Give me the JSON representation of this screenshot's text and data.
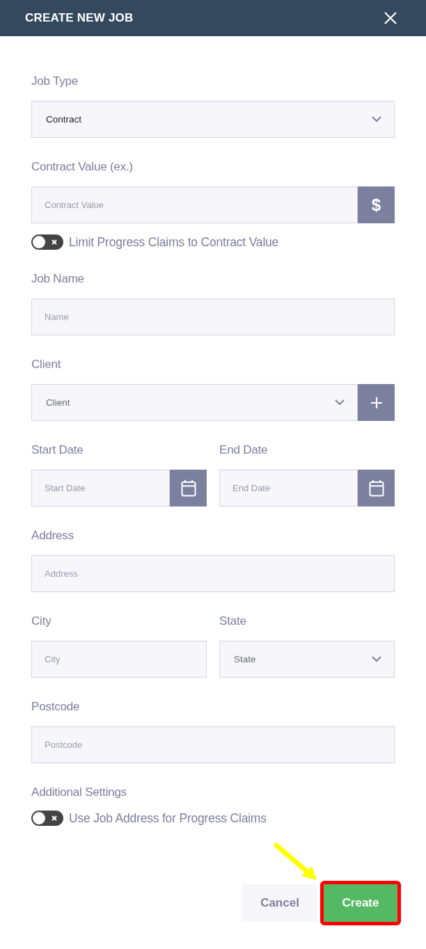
{
  "dialog": {
    "title": "CREATE NEW JOB"
  },
  "form": [
    {
      "kind": "select",
      "label": "Job Type",
      "value": "Contract"
    },
    {
      "kind": "input",
      "label": "Contract Value (ex.)",
      "placeholder": "Contract Value",
      "addon": {
        "kind": "text",
        "text": "$"
      }
    },
    {
      "kind": "toggle",
      "label": "Limit Progress Claims to Contract Value",
      "on": false
    },
    {
      "kind": "input",
      "label": "Job Name",
      "placeholder": "Name"
    },
    {
      "kind": "select",
      "label": "Client",
      "placeholder": "Client",
      "addon": {
        "kind": "add"
      }
    },
    {
      "kind": "row",
      "fields": [
        {
          "kind": "input",
          "label": "Start Date",
          "placeholder": "Start Date",
          "addon": {
            "kind": "calendar"
          }
        },
        {
          "kind": "input",
          "label": "End Date",
          "placeholder": "End Date",
          "addon": {
            "kind": "calendar"
          }
        }
      ]
    },
    {
      "kind": "input",
      "label": "Address",
      "placeholder": "Address"
    },
    {
      "kind": "row",
      "fields": [
        {
          "kind": "input",
          "label": "City",
          "placeholder": "City"
        },
        {
          "kind": "select",
          "label": "State",
          "placeholder": "State"
        }
      ]
    },
    {
      "kind": "input",
      "label": "Postcode",
      "placeholder": "Postcode"
    },
    {
      "kind": "heading",
      "label": "Additional Settings"
    },
    {
      "kind": "toggle",
      "label": "Use Job Address for Progress Claims",
      "on": false
    }
  ],
  "buttons": [
    {
      "label": "Cancel",
      "kind": "secondary",
      "highlighted": false
    },
    {
      "label": "Create",
      "kind": "primary",
      "highlighted": true
    }
  ]
}
